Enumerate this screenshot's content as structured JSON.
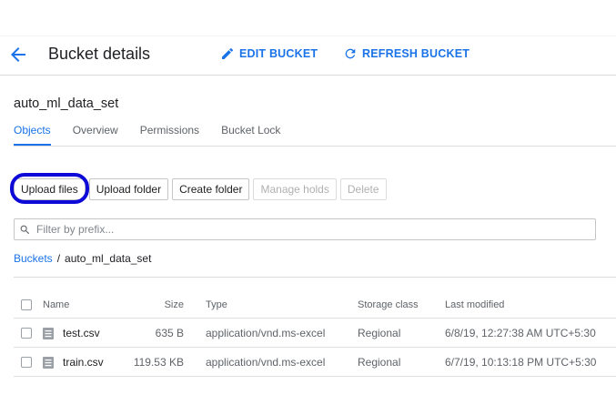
{
  "header": {
    "title": "Bucket details",
    "edit_label": "EDIT BUCKET",
    "refresh_label": "REFRESH BUCKET"
  },
  "bucket": {
    "name": "auto_ml_data_set"
  },
  "tabs": [
    {
      "label": "Objects",
      "active": true
    },
    {
      "label": "Overview",
      "active": false
    },
    {
      "label": "Permissions",
      "active": false
    },
    {
      "label": "Bucket Lock",
      "active": false
    }
  ],
  "toolbar": {
    "upload_files": "Upload files",
    "upload_folder": "Upload folder",
    "create_folder": "Create folder",
    "manage_holds": "Manage holds",
    "delete": "Delete"
  },
  "filter": {
    "placeholder": "Filter by prefix..."
  },
  "breadcrumb": {
    "root": "Buckets",
    "separator": "/",
    "current": "auto_ml_data_set"
  },
  "table": {
    "columns": {
      "name": "Name",
      "size": "Size",
      "type": "Type",
      "storage_class": "Storage class",
      "last_modified": "Last modified"
    },
    "rows": [
      {
        "name": "test.csv",
        "size": "635 B",
        "type": "application/vnd.ms-excel",
        "storage_class": "Regional",
        "last_modified": "6/8/19, 12:27:38 AM UTC+5:30"
      },
      {
        "name": "train.csv",
        "size": "119.53 KB",
        "type": "application/vnd.ms-excel",
        "storage_class": "Regional",
        "last_modified": "6/7/19, 10:13:18 PM UTC+5:30"
      }
    ]
  },
  "colors": {
    "accent": "#1a73e8",
    "highlight": "#0d0ad8"
  }
}
